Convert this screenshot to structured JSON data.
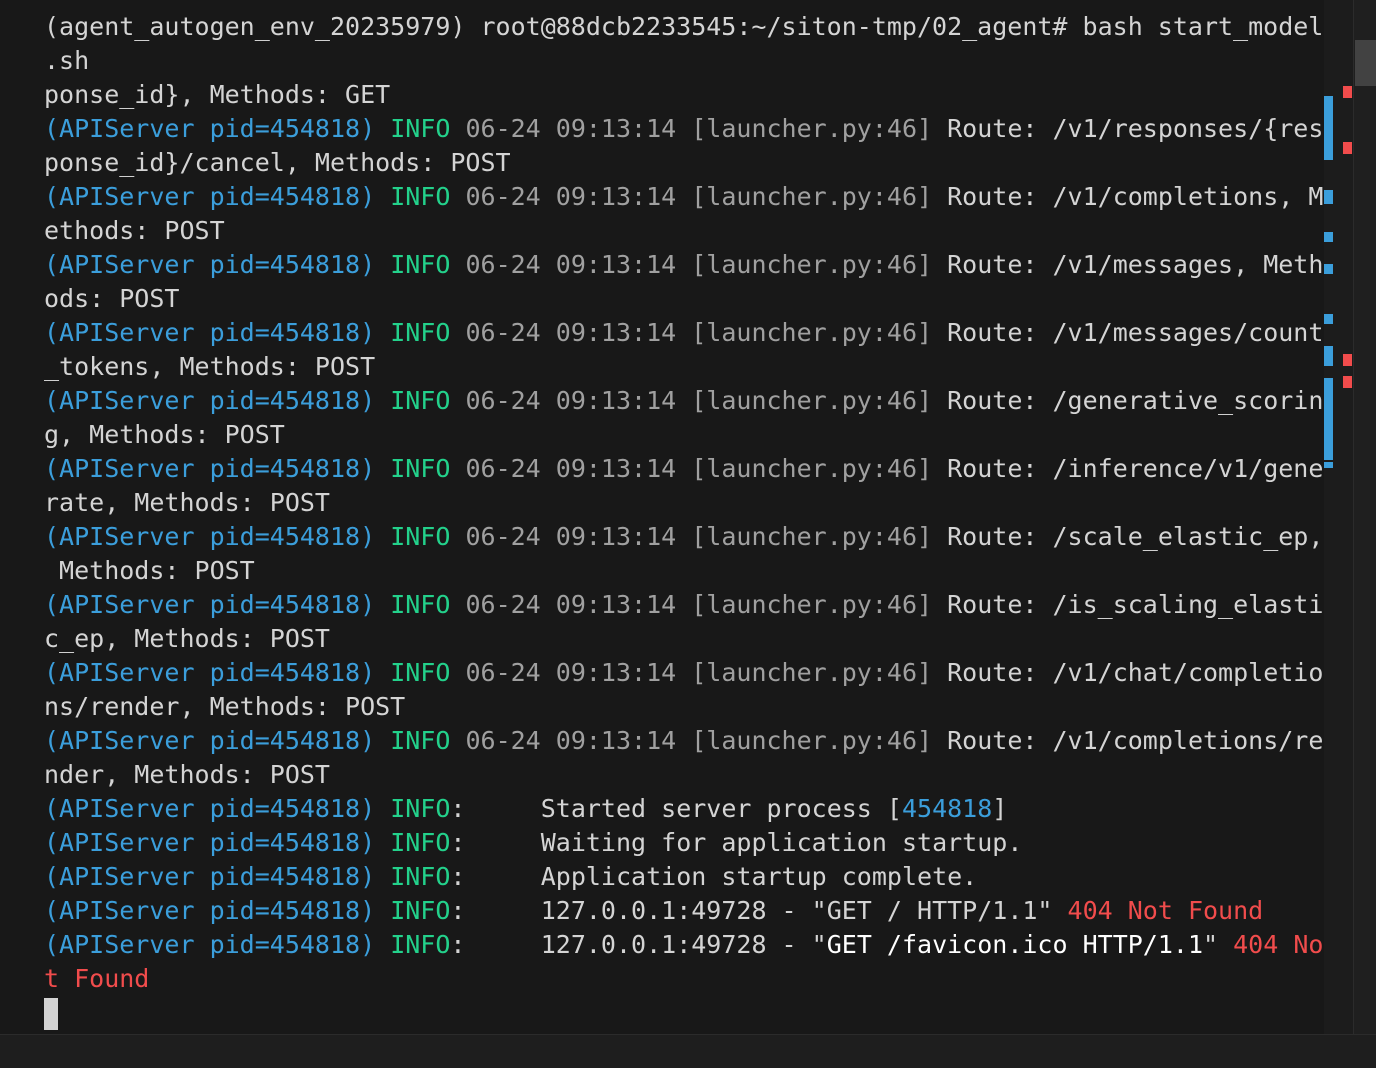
{
  "terminal": {
    "lines": [
      [
        {
          "t": "(agent_autogen_env_20235979) root@88dcb2233545:~/siton-tmp/02_agent# bash start_model",
          "c": "default"
        }
      ],
      [
        {
          "t": ".sh",
          "c": "default"
        }
      ],
      [
        {
          "t": "ponse_id}, Methods: GET",
          "c": "default"
        }
      ],
      [
        {
          "t": "(APIServer pid=454818)",
          "c": "blue"
        },
        {
          "t": " ",
          "c": "default"
        },
        {
          "t": "INFO",
          "c": "green"
        },
        {
          "t": " 06-24 09:13:14 [launcher.py:46] ",
          "c": "dim"
        },
        {
          "t": "Route: /v1/responses/{res",
          "c": "default"
        }
      ],
      [
        {
          "t": "ponse_id}/cancel, Methods: POST",
          "c": "default"
        }
      ],
      [
        {
          "t": "(APIServer pid=454818)",
          "c": "blue"
        },
        {
          "t": " ",
          "c": "default"
        },
        {
          "t": "INFO",
          "c": "green"
        },
        {
          "t": " 06-24 09:13:14 [launcher.py:46] ",
          "c": "dim"
        },
        {
          "t": "Route: /v1/completions, M",
          "c": "default"
        }
      ],
      [
        {
          "t": "ethods: POST",
          "c": "default"
        }
      ],
      [
        {
          "t": "(APIServer pid=454818)",
          "c": "blue"
        },
        {
          "t": " ",
          "c": "default"
        },
        {
          "t": "INFO",
          "c": "green"
        },
        {
          "t": " 06-24 09:13:14 [launcher.py:46] ",
          "c": "dim"
        },
        {
          "t": "Route: /v1/messages, Meth",
          "c": "default"
        }
      ],
      [
        {
          "t": "ods: POST",
          "c": "default"
        }
      ],
      [
        {
          "t": "(APIServer pid=454818)",
          "c": "blue"
        },
        {
          "t": " ",
          "c": "default"
        },
        {
          "t": "INFO",
          "c": "green"
        },
        {
          "t": " 06-24 09:13:14 [launcher.py:46] ",
          "c": "dim"
        },
        {
          "t": "Route: /v1/messages/count",
          "c": "default"
        }
      ],
      [
        {
          "t": "_tokens, Methods: POST",
          "c": "default"
        }
      ],
      [
        {
          "t": "(APIServer pid=454818)",
          "c": "blue"
        },
        {
          "t": " ",
          "c": "default"
        },
        {
          "t": "INFO",
          "c": "green"
        },
        {
          "t": " 06-24 09:13:14 [launcher.py:46] ",
          "c": "dim"
        },
        {
          "t": "Route: /generative_scorin",
          "c": "default"
        }
      ],
      [
        {
          "t": "g, Methods: POST",
          "c": "default"
        }
      ],
      [
        {
          "t": "(APIServer pid=454818)",
          "c": "blue"
        },
        {
          "t": " ",
          "c": "default"
        },
        {
          "t": "INFO",
          "c": "green"
        },
        {
          "t": " 06-24 09:13:14 [launcher.py:46] ",
          "c": "dim"
        },
        {
          "t": "Route: /inference/v1/gene",
          "c": "default"
        }
      ],
      [
        {
          "t": "rate, Methods: POST",
          "c": "default"
        }
      ],
      [
        {
          "t": "(APIServer pid=454818)",
          "c": "blue"
        },
        {
          "t": " ",
          "c": "default"
        },
        {
          "t": "INFO",
          "c": "green"
        },
        {
          "t": " 06-24 09:13:14 [launcher.py:46] ",
          "c": "dim"
        },
        {
          "t": "Route: /scale_elastic_ep,",
          "c": "default"
        }
      ],
      [
        {
          "t": " Methods: POST",
          "c": "default"
        }
      ],
      [
        {
          "t": "(APIServer pid=454818)",
          "c": "blue"
        },
        {
          "t": " ",
          "c": "default"
        },
        {
          "t": "INFO",
          "c": "green"
        },
        {
          "t": " 06-24 09:13:14 [launcher.py:46] ",
          "c": "dim"
        },
        {
          "t": "Route: /is_scaling_elasti",
          "c": "default"
        }
      ],
      [
        {
          "t": "c_ep, Methods: POST",
          "c": "default"
        }
      ],
      [
        {
          "t": "(APIServer pid=454818)",
          "c": "blue"
        },
        {
          "t": " ",
          "c": "default"
        },
        {
          "t": "INFO",
          "c": "green"
        },
        {
          "t": " 06-24 09:13:14 [launcher.py:46] ",
          "c": "dim"
        },
        {
          "t": "Route: /v1/chat/completio",
          "c": "default"
        }
      ],
      [
        {
          "t": "ns/render, Methods: POST",
          "c": "default"
        }
      ],
      [
        {
          "t": "(APIServer pid=454818)",
          "c": "blue"
        },
        {
          "t": " ",
          "c": "default"
        },
        {
          "t": "INFO",
          "c": "green"
        },
        {
          "t": " 06-24 09:13:14 [launcher.py:46] ",
          "c": "dim"
        },
        {
          "t": "Route: /v1/completions/re",
          "c": "default"
        }
      ],
      [
        {
          "t": "nder, Methods: POST",
          "c": "default"
        }
      ],
      [
        {
          "t": "(APIServer pid=454818)",
          "c": "blue"
        },
        {
          "t": " ",
          "c": "default"
        },
        {
          "t": "INFO",
          "c": "green"
        },
        {
          "t": ":     Started server process [",
          "c": "default"
        },
        {
          "t": "454818",
          "c": "blue"
        },
        {
          "t": "]",
          "c": "default"
        }
      ],
      [
        {
          "t": "(APIServer pid=454818)",
          "c": "blue"
        },
        {
          "t": " ",
          "c": "default"
        },
        {
          "t": "INFO",
          "c": "green"
        },
        {
          "t": ":     Waiting for application startup.",
          "c": "default"
        }
      ],
      [
        {
          "t": "(APIServer pid=454818)",
          "c": "blue"
        },
        {
          "t": " ",
          "c": "default"
        },
        {
          "t": "INFO",
          "c": "green"
        },
        {
          "t": ":     Application startup complete.",
          "c": "default"
        }
      ],
      [
        {
          "t": "(APIServer pid=454818)",
          "c": "blue"
        },
        {
          "t": " ",
          "c": "default"
        },
        {
          "t": "INFO",
          "c": "green"
        },
        {
          "t": ":     127.0.0.1:49728 - \"GET / HTTP/1.1\" ",
          "c": "default"
        },
        {
          "t": "404 Not Found",
          "c": "red"
        }
      ],
      [
        {
          "t": "(APIServer pid=454818)",
          "c": "blue"
        },
        {
          "t": " ",
          "c": "default"
        },
        {
          "t": "INFO",
          "c": "green"
        },
        {
          "t": ":     127.0.0.1:49728 - \"",
          "c": "default"
        },
        {
          "t": "GET /favicon.ico HTTP/1.1",
          "c": "white"
        },
        {
          "t": "\" ",
          "c": "default"
        },
        {
          "t": "404 No",
          "c": "red"
        }
      ],
      [
        {
          "t": "t Found",
          "c": "red"
        }
      ]
    ],
    "colors": {
      "background": "#181818",
      "default": "#d4d4d4",
      "blue": "#3b9edb",
      "green": "#23d18b",
      "dim": "#a0a0a0",
      "red": "#f14c4c",
      "white": "#ffffff"
    }
  },
  "overview_ruler": {
    "marks": [
      {
        "color": "#3b9edb"
      },
      {
        "color": "#f14c4c"
      },
      {
        "color": "#3b9edb"
      },
      {
        "color": "#f14c4c"
      },
      {
        "color": "#3b9edb"
      },
      {
        "color": "#3b9edb"
      },
      {
        "color": "#3b9edb"
      },
      {
        "color": "#3b9edb"
      },
      {
        "color": "#3b9edb"
      },
      {
        "color": "#f14c4c"
      },
      {
        "color": "#f14c4c"
      },
      {
        "color": "#3b9edb"
      }
    ]
  }
}
